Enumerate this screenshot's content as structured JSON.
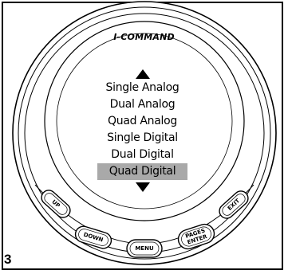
{
  "brand": "I-COMMAND",
  "menu_items": [
    {
      "label": "Single Analog",
      "selected": false
    },
    {
      "label": "Dual Analog",
      "selected": false
    },
    {
      "label": "Quad Analog",
      "selected": false
    },
    {
      "label": "Single Digital",
      "selected": false
    },
    {
      "label": "Dual Digital",
      "selected": false
    },
    {
      "label": "Quad Digital",
      "selected": true
    }
  ],
  "buttons": {
    "up": "UP",
    "down": "DOWN",
    "menu": "MENU",
    "pages_enter_line1": "PAGES",
    "pages_enter_line2": "ENTER",
    "exit": "EXIT"
  },
  "figure_number": "3",
  "colors": {
    "selection_highlight": "#a9a9a9",
    "outline": "#000000",
    "background": "#ffffff"
  }
}
